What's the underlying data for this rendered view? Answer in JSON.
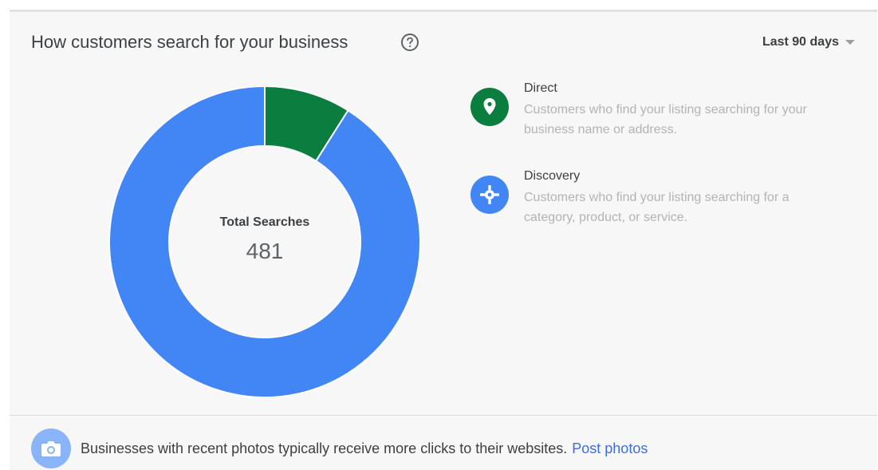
{
  "header": {
    "title": "How customers search for your business",
    "help_icon": "help-circle-icon",
    "range_label": "Last 90 days",
    "range_icon": "caret-down-icon"
  },
  "chart_data": {
    "type": "pie",
    "center_title": "Total Searches",
    "center_value": "481",
    "categories": [
      "Direct",
      "Discovery"
    ],
    "values": [
      0.09,
      0.91
    ],
    "colors": [
      "#0b7d3e",
      "#4285f4"
    ]
  },
  "legend": [
    {
      "name": "Direct",
      "description": "Customers who find your listing searching for your business name or address.",
      "icon": "location-pin-icon",
      "color": "#0b7d3e"
    },
    {
      "name": "Discovery",
      "description": "Customers who find your listing searching for a category, product, or service.",
      "icon": "compass-icon",
      "color": "#4285f4"
    }
  ],
  "footer": {
    "text": "Businesses with recent photos typically receive more clicks to their websites.",
    "link": "Post photos",
    "icon": "camera-icon",
    "link_color": "#3a6fd8"
  }
}
